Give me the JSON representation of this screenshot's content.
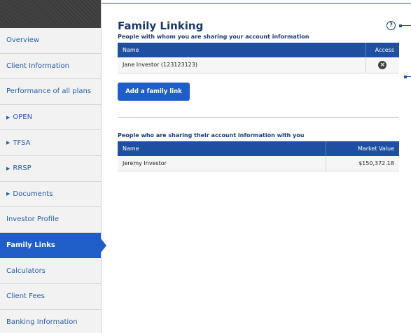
{
  "sidebar": {
    "items": [
      {
        "label": "Overview"
      },
      {
        "label": "Client Information"
      },
      {
        "label": "Performance of all plans"
      },
      {
        "label": "OPEN"
      },
      {
        "label": "TFSA"
      },
      {
        "label": "RRSP"
      },
      {
        "label": "Documents"
      },
      {
        "label": "Investor Profile"
      },
      {
        "label": "Family Links"
      },
      {
        "label": "Calculators"
      },
      {
        "label": "Client Fees"
      },
      {
        "label": "Banking Information"
      }
    ]
  },
  "page": {
    "title": "Family Linking",
    "help_icon": "?"
  },
  "sharing_with": {
    "title": "People with whom you are sharing your account information",
    "columns": [
      "Name",
      "Access"
    ],
    "rows": [
      {
        "name": "Jane Investor (123123123)",
        "access_icon": "remove-circle-icon"
      }
    ],
    "add_button": "Add a family link"
  },
  "sharing_from": {
    "title": "People who are sharing their account information with you",
    "columns": [
      "Name",
      "Market Value"
    ],
    "rows": [
      {
        "name": "Jeremy Investor",
        "market_value": "$150,372.18"
      }
    ]
  },
  "colors": {
    "accent": "#1f5dc8",
    "header": "#1f4fa0",
    "title": "#1b3a6b"
  }
}
